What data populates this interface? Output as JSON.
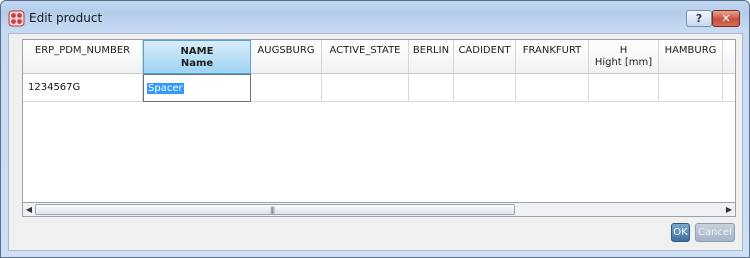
{
  "window": {
    "title": "Edit product",
    "help_label": "?",
    "close_label": "✕"
  },
  "grid": {
    "columns": [
      {
        "line1": "ERP_PDM_NUMBER",
        "line2": ""
      },
      {
        "line1": "NAME",
        "line2": "Name"
      },
      {
        "line1": "AUGSBURG",
        "line2": ""
      },
      {
        "line1": "ACTIVE_STATE",
        "line2": ""
      },
      {
        "line1": "BERLIN",
        "line2": ""
      },
      {
        "line1": "CADIDENT",
        "line2": ""
      },
      {
        "line1": "FRANKFURT",
        "line2": ""
      },
      {
        "line1": "H",
        "line2": "Hight [mm]"
      },
      {
        "line1": "HAMBURG",
        "line2": ""
      }
    ],
    "row": {
      "erp_pdm_number": "1234567G",
      "name_value": "Spacer"
    },
    "selected_column": "NAME"
  },
  "scrollbar": {
    "left_arrow": "◀",
    "right_arrow": "▶",
    "grip": "|||"
  },
  "buttons": {
    "ok_label": "OK",
    "cancel_label": "Cancel"
  },
  "icons": {
    "app": "edit-product-app-icon",
    "help": "help-icon",
    "close": "close-icon"
  }
}
